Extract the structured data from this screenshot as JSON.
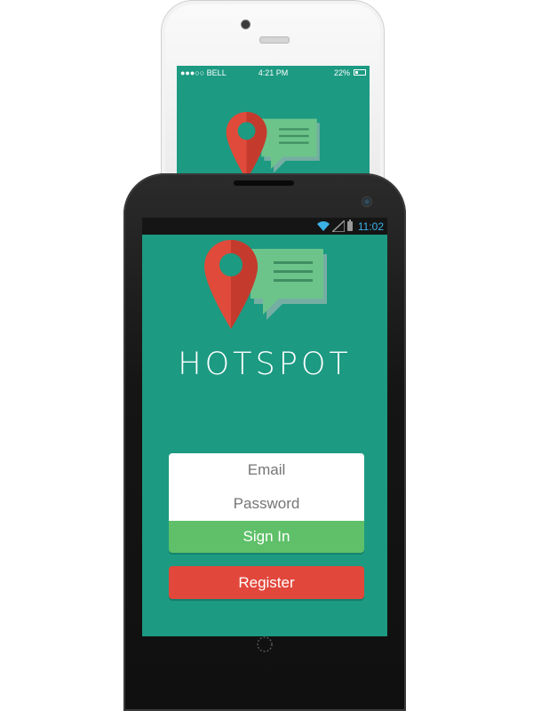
{
  "iphone": {
    "status": {
      "carrier": "●●●○○ BELL",
      "time": "4:21 PM",
      "battery": "22%"
    }
  },
  "android": {
    "status": {
      "time": "11:02"
    },
    "app": {
      "title": "HOTSPOT",
      "email_placeholder": "Email",
      "password_placeholder": "Password",
      "signin_label": "Sign In",
      "register_label": "Register"
    }
  },
  "colors": {
    "screen_bg": "#1c9a82",
    "pin_red": "#e04a3a",
    "bubble_green": "#6cc48a",
    "signin_green": "#5fc069",
    "register_red": "#e2473b"
  },
  "icons": {
    "logo": "location-pin-chat-bubble-icon",
    "wifi": "wifi-icon",
    "signal": "signal-icon",
    "battery": "battery-icon",
    "home": "home-button-icon"
  }
}
